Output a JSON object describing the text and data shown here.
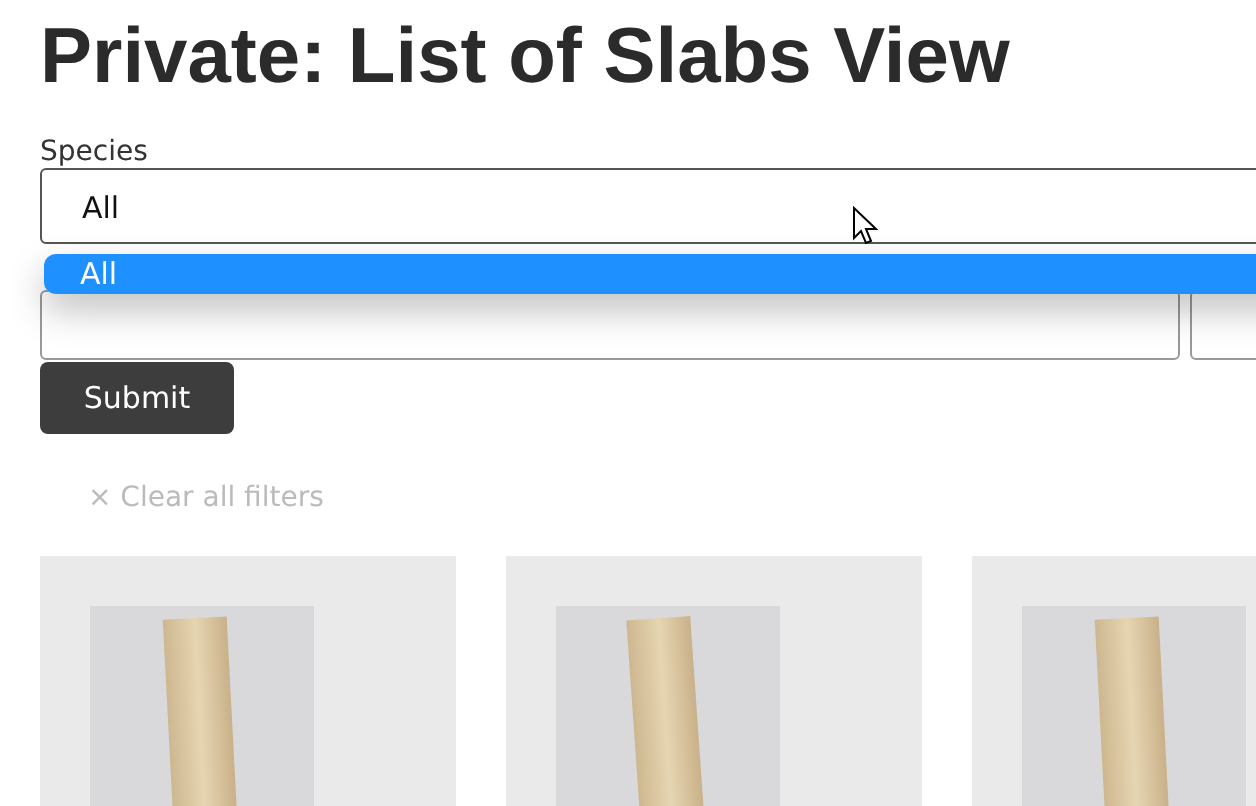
{
  "page": {
    "title": "Private: List of Slabs View"
  },
  "filters": {
    "species": {
      "label": "Species",
      "value": "All",
      "expanded": true,
      "options": [
        {
          "label": "All",
          "selected": true
        }
      ]
    },
    "submit": "Submit",
    "clear": {
      "icon": "×",
      "label": "Clear all filters"
    }
  },
  "cards": [
    {
      "kind": "slab"
    },
    {
      "kind": "slab"
    },
    {
      "kind": "slab"
    }
  ]
}
